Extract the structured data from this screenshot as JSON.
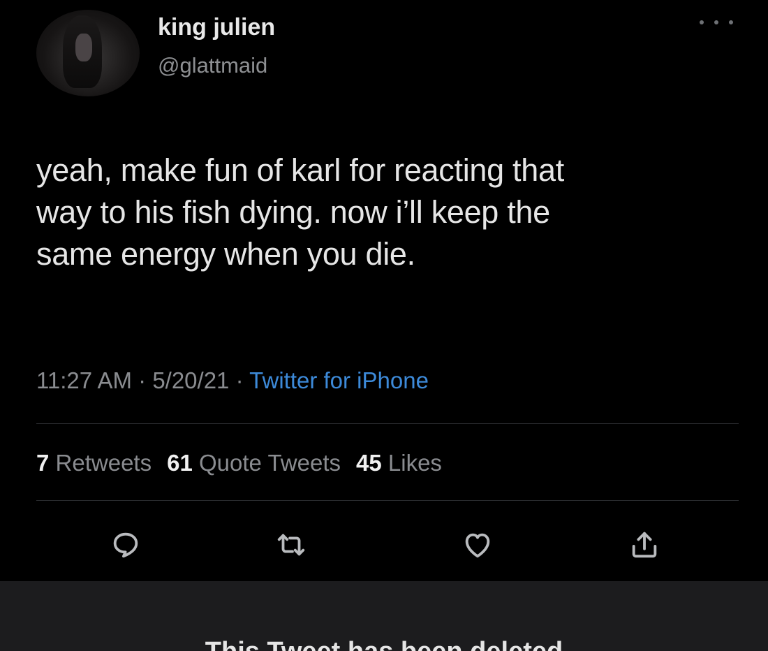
{
  "tweet": {
    "author": {
      "display_name": "king julien",
      "handle": "@glattmaid"
    },
    "text_lines": [
      "yeah, make fun of karl for reacting that",
      "way to his fish dying. now i’ll keep the",
      "same energy when you die."
    ],
    "meta": {
      "time": "11:27 AM",
      "separator": " · ",
      "date": "5/20/21",
      "source": "Twitter for iPhone"
    },
    "stats": {
      "retweets_count": "7",
      "retweets_label": "Retweets",
      "quote_tweets_count": "61",
      "quote_tweets_label": "Quote Tweets",
      "likes_count": "45",
      "likes_label": "Likes"
    },
    "actions": [
      {
        "icon": "reply-icon"
      },
      {
        "icon": "retweet-icon"
      },
      {
        "icon": "like-icon"
      },
      {
        "icon": "share-icon"
      }
    ]
  },
  "banner": {
    "message": "This Tweet has been deleted"
  },
  "colors": {
    "background": "#000000",
    "text": "#e6e6e6",
    "secondary_text": "#8a8c90",
    "link": "#3d8ad9",
    "banner_background": "#1c1c1e"
  }
}
